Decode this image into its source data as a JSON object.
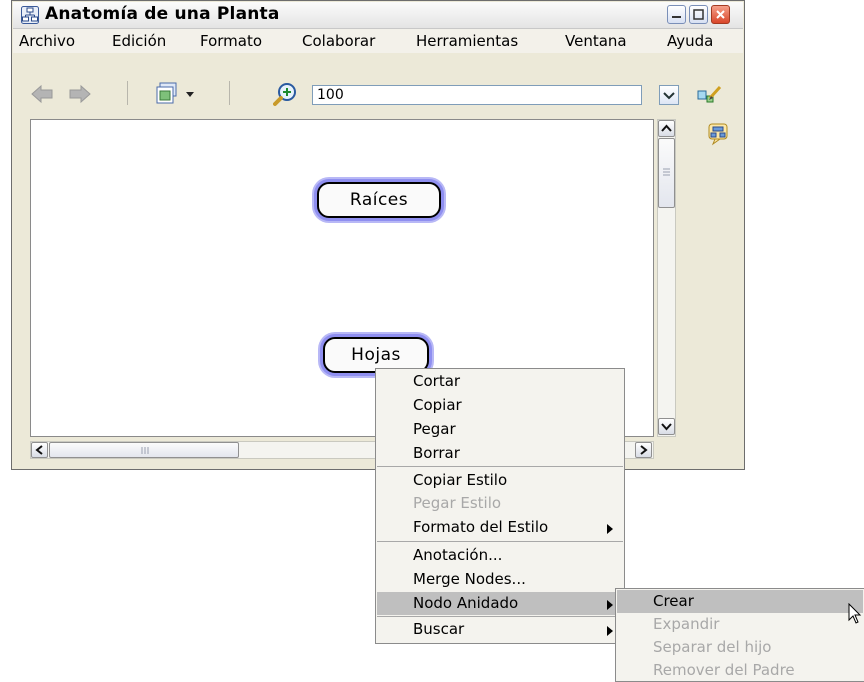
{
  "window": {
    "title": "Anatomía de una Planta",
    "controls": {
      "minimize": "minimize-icon",
      "maximize": "maximize-icon",
      "close": "close-icon"
    }
  },
  "menubar": {
    "items": [
      "Archivo",
      "Edición",
      "Formato",
      "Colaborar",
      "Herramientas",
      "Ventana",
      "Ayuda"
    ]
  },
  "toolbar": {
    "zoom_value": "100",
    "icons": [
      "back-arrow-icon",
      "forward-arrow-icon",
      "view-mode-icon",
      "zoom-icon",
      "dropdown-icon",
      "edit-tool-icon"
    ]
  },
  "canvas": {
    "nodes": [
      "Raíces",
      "Hojas"
    ]
  },
  "context_menu": {
    "items": [
      {
        "label": "Cortar",
        "enabled": true
      },
      {
        "label": "Copiar",
        "enabled": true
      },
      {
        "label": "Pegar",
        "enabled": true
      },
      {
        "label": "Borrar",
        "enabled": true
      },
      {
        "label": "Copiar Estilo",
        "enabled": true
      },
      {
        "label": "Pegar Estilo",
        "enabled": false
      },
      {
        "label": "Formato del Estilo",
        "enabled": true,
        "submenu": true
      },
      {
        "label": "Anotación...",
        "enabled": true
      },
      {
        "label": "Merge Nodes...",
        "enabled": true
      },
      {
        "label": "Nodo Anidado",
        "enabled": true,
        "submenu": true,
        "highlighted": true
      },
      {
        "label": "Buscar",
        "enabled": true,
        "submenu": true
      }
    ]
  },
  "submenu": {
    "items": [
      {
        "label": "Crear",
        "enabled": true,
        "highlighted": true
      },
      {
        "label": "Expandir",
        "enabled": false
      },
      {
        "label": "Separar del hijo",
        "enabled": false
      },
      {
        "label": "Remover del Padre",
        "enabled": false
      }
    ]
  },
  "colors": {
    "node_glow": "#8f8ff0",
    "highlight": "#bfbfbf",
    "disabled_text": "#a8a8a8"
  }
}
